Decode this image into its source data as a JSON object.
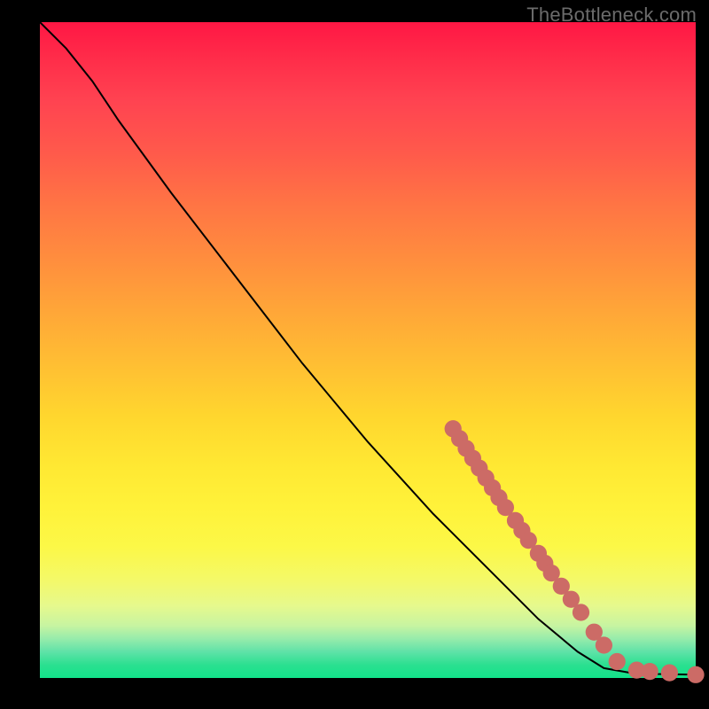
{
  "watermark": "TheBottleneck.com",
  "colors": {
    "background": "#000000",
    "curve": "#000000",
    "marker": "#cc6b66",
    "gradient_top": "#ff1744",
    "gradient_bottom": "#12e28a"
  },
  "chart_data": {
    "type": "line",
    "title": "",
    "xlabel": "",
    "ylabel": "",
    "xlim": [
      0,
      100
    ],
    "ylim": [
      0,
      100
    ],
    "curve": [
      {
        "x": 0,
        "y": 100
      },
      {
        "x": 4,
        "y": 96
      },
      {
        "x": 8,
        "y": 91
      },
      {
        "x": 12,
        "y": 85
      },
      {
        "x": 20,
        "y": 74
      },
      {
        "x": 30,
        "y": 61
      },
      {
        "x": 40,
        "y": 48
      },
      {
        "x": 50,
        "y": 36
      },
      {
        "x": 60,
        "y": 25
      },
      {
        "x": 68,
        "y": 17
      },
      {
        "x": 76,
        "y": 9
      },
      {
        "x": 82,
        "y": 4
      },
      {
        "x": 86,
        "y": 1.5
      },
      {
        "x": 90,
        "y": 0.8
      },
      {
        "x": 94,
        "y": 0.6
      },
      {
        "x": 100,
        "y": 0.5
      }
    ],
    "markers": [
      {
        "x": 63,
        "y": 38
      },
      {
        "x": 64,
        "y": 36.5
      },
      {
        "x": 65,
        "y": 35
      },
      {
        "x": 66,
        "y": 33.5
      },
      {
        "x": 67,
        "y": 32
      },
      {
        "x": 68,
        "y": 30.5
      },
      {
        "x": 69,
        "y": 29
      },
      {
        "x": 70,
        "y": 27.5
      },
      {
        "x": 71,
        "y": 26
      },
      {
        "x": 72.5,
        "y": 24
      },
      {
        "x": 73.5,
        "y": 22.5
      },
      {
        "x": 74.5,
        "y": 21
      },
      {
        "x": 76,
        "y": 19
      },
      {
        "x": 77,
        "y": 17.5
      },
      {
        "x": 78,
        "y": 16
      },
      {
        "x": 79.5,
        "y": 14
      },
      {
        "x": 81,
        "y": 12
      },
      {
        "x": 82.5,
        "y": 10
      },
      {
        "x": 84.5,
        "y": 7
      },
      {
        "x": 86,
        "y": 5
      },
      {
        "x": 88,
        "y": 2.5
      },
      {
        "x": 91,
        "y": 1.2
      },
      {
        "x": 93,
        "y": 1.0
      },
      {
        "x": 96,
        "y": 0.8
      },
      {
        "x": 100,
        "y": 0.5
      }
    ],
    "marker_radius_data_units": 1.3
  }
}
